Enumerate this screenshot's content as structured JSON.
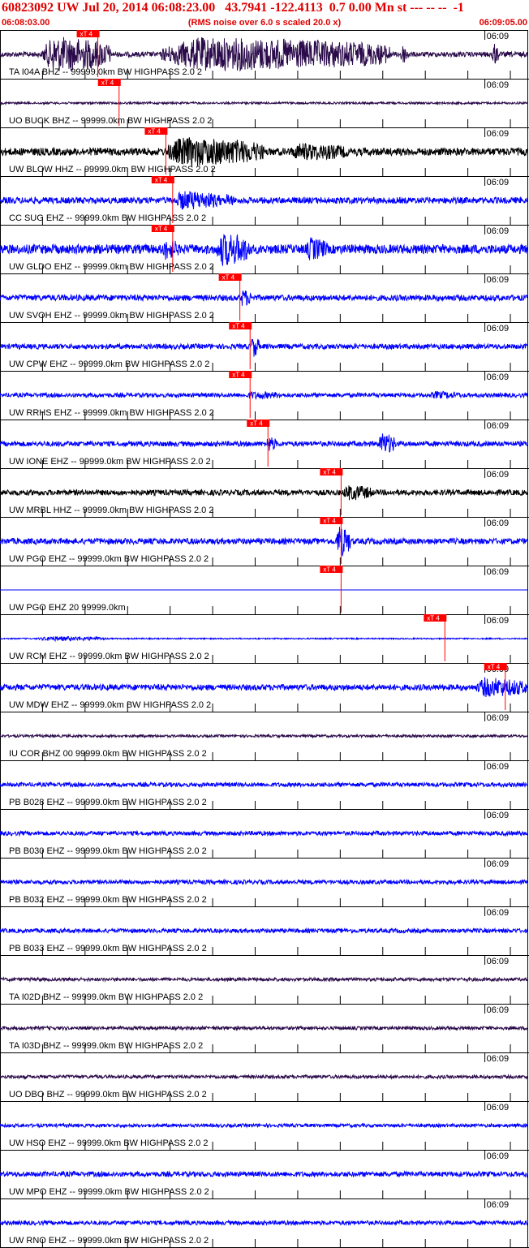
{
  "header": {
    "title": "60823092 UW Jul 20, 2014 06:08:23.00   43.7941 -122.4113  0.7 0.00 Mn st --- -- --  -1",
    "start_time": "06:08:03.00",
    "scale_note": "(RMS noise over 6.0 s scaled 20.0 x)",
    "end_time": "06:09:05.00"
  },
  "colors": {
    "header_text": "#e00000",
    "pick_box": "#ff0000",
    "pick_line": "#ff0000",
    "trace_black": "#000000",
    "trace_blue": "#0000ff",
    "trace_purple": "#2a0a4a",
    "tick": "#000000"
  },
  "chart_data": {
    "type": "line",
    "title": "60823092 UW Jul 20, 2014 06:08:23.00   43.7941 -122.4113  0.7 0.00 Mn st --- -- --  -1",
    "x_range": [
      "06:08:03.00",
      "06:09:05.00"
    ],
    "xlabel": "",
    "ylabel": "",
    "time_tick_label": "06:09",
    "pick_label": "xT 4",
    "traces": [
      {
        "label": "TA I04A BHZ -- 99999.0km BW  HIGHPASS  2.0  2",
        "color": "purple",
        "pick": 11.5,
        "amp": 0.12,
        "bursts": [
          [
            5,
            13,
            0.9
          ],
          [
            19,
            46,
            0.85
          ],
          [
            47,
            48,
            0.5
          ],
          [
            57.8,
            58.6,
            0.6
          ]
        ]
      },
      {
        "label": "UO BUCK BHZ -- 99999.0km BW  HIGHPASS  2.0  2",
        "color": "purple",
        "pick": 14.0,
        "amp": 0.05,
        "bursts": []
      },
      {
        "label": "UW BLOW HHZ -- 99999.0km BW  HIGHPASS  2.0  2",
        "color": "black",
        "pick": 19.5,
        "amp": 0.18,
        "bursts": [
          [
            19.5,
            31,
            0.75
          ],
          [
            34,
            41,
            0.45
          ]
        ]
      },
      {
        "label": "CC SUG EHZ -- 99999.0km BW  HIGHPASS  2.0  2",
        "color": "blue",
        "pick": 20.3,
        "amp": 0.15,
        "bursts": [
          [
            20.5,
            26,
            0.5
          ],
          [
            26.5,
            27.5,
            0.35
          ]
        ]
      },
      {
        "label": "UW GLDO EHZ -- 99999.0km BW  HIGHPASS  2.0  2",
        "color": "blue",
        "pick": 20.3,
        "amp": 0.22,
        "bursts": [
          [
            19,
            21,
            0.55
          ],
          [
            25.5,
            29.5,
            0.85
          ],
          [
            36,
            38.5,
            0.6
          ]
        ]
      },
      {
        "label": "UW SVOH EHZ -- 99999.0km BW  HIGHPASS  2.0  2",
        "color": "blue",
        "pick": 28.2,
        "amp": 0.14,
        "bursts": [
          [
            28.3,
            29.5,
            0.45
          ]
        ]
      },
      {
        "label": "UW CPW EHZ -- 99999.0km BW  HIGHPASS  2.0  2",
        "color": "blue",
        "pick": 29.4,
        "amp": 0.12,
        "bursts": [
          [
            29.5,
            30.5,
            0.55
          ]
        ]
      },
      {
        "label": "UW RRHS EHZ -- 99999.0km BW  HIGHPASS  2.0  2",
        "color": "blue",
        "pick": 29.4,
        "amp": 0.1,
        "bursts": [
          [
            28.8,
            33.5,
            0.2
          ],
          [
            50.5,
            54.5,
            0.2
          ]
        ]
      },
      {
        "label": "UW IONE EHZ -- 99999.0km BW  HIGHPASS  2.0  2",
        "color": "blue",
        "pick": 31.5,
        "amp": 0.12,
        "bursts": [
          [
            31.3,
            32.5,
            0.4
          ],
          [
            44.5,
            46.5,
            0.55
          ]
        ]
      },
      {
        "label": "UW MRBL HHZ -- 99999.0km BW  HIGHPASS  2.0  2",
        "color": "black",
        "pick": 40.1,
        "amp": 0.13,
        "bursts": [
          [
            40.3,
            43.8,
            0.4
          ]
        ]
      },
      {
        "label": "UW PGO EHZ -- 99999.0km BW  HIGHPASS  2.0  2",
        "color": "blue",
        "pick": 40.1,
        "amp": 0.14,
        "bursts": [
          [
            39.5,
            41.2,
            0.8
          ]
        ]
      },
      {
        "label": "UW PGO EHZ 20 99999.0km",
        "color": "blue",
        "pick": 40.1,
        "amp": 0.0,
        "bursts": []
      },
      {
        "label": "UW RCM EHZ -- 99999.0km BW  HIGHPASS  2.0  2",
        "color": "blue",
        "pick": 52.3,
        "amp": 0.03,
        "bursts": [
          [
            4.5,
            12.5,
            0.12
          ]
        ]
      },
      {
        "label": "UW MDW EHZ -- 99999.0km BW  HIGHPASS  2.0  2",
        "color": "blue",
        "pick": 59.4,
        "amp": 0.14,
        "bursts": [
          [
            56,
            62,
            0.5
          ]
        ]
      },
      {
        "label": "IU COR BHZ 00 99999.0km BW  HIGHPASS  2.0  2",
        "color": "purple",
        "pick": null,
        "amp": 0.06,
        "bursts": []
      },
      {
        "label": "PB B028 EHZ -- 99999.0km BW  HIGHPASS  2.0  2",
        "color": "blue",
        "pick": null,
        "amp": 0.1,
        "bursts": []
      },
      {
        "label": "PB B030 EHZ -- 99999.0km BW  HIGHPASS  2.0  2",
        "color": "blue",
        "pick": null,
        "amp": 0.1,
        "bursts": []
      },
      {
        "label": "PB B032 EHZ -- 99999.0km BW  HIGHPASS  2.0  2",
        "color": "blue",
        "pick": null,
        "amp": 0.1,
        "bursts": []
      },
      {
        "label": "PB B033 EHZ -- 99999.0km BW  HIGHPASS  2.0  2",
        "color": "blue",
        "pick": null,
        "amp": 0.1,
        "bursts": []
      },
      {
        "label": "TA I02D BHZ -- 99999.0km BW  HIGHPASS  2.0  2",
        "color": "purple",
        "pick": null,
        "amp": 0.08,
        "bursts": []
      },
      {
        "label": "TA I03D BHZ -- 99999.0km BW  HIGHPASS  2.0  2",
        "color": "purple",
        "pick": null,
        "amp": 0.08,
        "bursts": []
      },
      {
        "label": "UO DBO BHZ -- 99999.0km BW  HIGHPASS  2.0  2",
        "color": "purple",
        "pick": null,
        "amp": 0.08,
        "bursts": []
      },
      {
        "label": "UW HSO EHZ -- 99999.0km BW  HIGHPASS  2.0  2",
        "color": "blue",
        "pick": null,
        "amp": 0.08,
        "bursts": []
      },
      {
        "label": "UW MPO EHZ -- 99999.0km BW  HIGHPASS  2.0  2",
        "color": "blue",
        "pick": null,
        "amp": 0.12,
        "bursts": []
      },
      {
        "label": "UW RNO EHZ -- 99999.0km BW  HIGHPASS  2.0  2",
        "color": "blue",
        "pick": null,
        "amp": 0.1,
        "bursts": []
      }
    ]
  }
}
